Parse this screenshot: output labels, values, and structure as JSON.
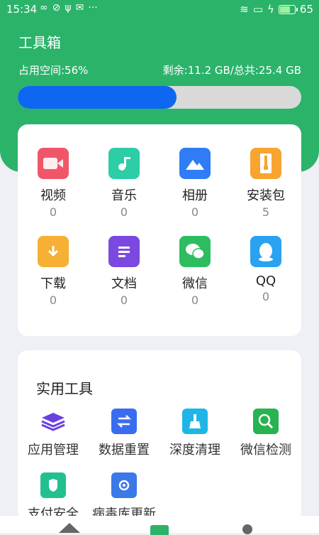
{
  "status": {
    "time": "15:34",
    "left_icons": [
      "infinity-icon",
      "check-circle-icon",
      "usb-icon",
      "mail-icon",
      "more-icon"
    ],
    "battery": "65"
  },
  "header": {
    "title": "工具箱",
    "usage_label": "占用空间:56%",
    "storage_label": "剩余:11.2 GB/总共:25.4 GB",
    "usage_percent": 56,
    "accent": "#2bb36a",
    "progress_color": "#0d67f0"
  },
  "categories": [
    {
      "label": "视频",
      "count": "0",
      "icon": "video-icon",
      "color": "#f0566a"
    },
    {
      "label": "音乐",
      "count": "0",
      "icon": "music-folder-icon",
      "color": "#2dcda5"
    },
    {
      "label": "相册",
      "count": "0",
      "icon": "photo-icon",
      "color": "#2f7cf6"
    },
    {
      "label": "安装包",
      "count": "5",
      "icon": "zip-icon",
      "color": "#f7a431"
    },
    {
      "label": "下载",
      "count": "0",
      "icon": "download-folder-icon",
      "color": "#f6b033"
    },
    {
      "label": "文档",
      "count": "0",
      "icon": "document-icon",
      "color": "#7b49e0"
    },
    {
      "label": "微信",
      "count": "0",
      "icon": "wechat-icon",
      "color": "#2dbd5f"
    },
    {
      "label": "QQ",
      "count": "0",
      "icon": "qq-icon",
      "color": "#2aa2f0"
    }
  ],
  "tools": {
    "title": "实用工具",
    "items": [
      {
        "label": "应用管理",
        "icon": "layers-icon",
        "color": "#6a3fe0"
      },
      {
        "label": "数据重置",
        "icon": "swap-icon",
        "color": "#3a6cf0"
      },
      {
        "label": "深度清理",
        "icon": "broom-icon",
        "color": "#1fb6e6"
      },
      {
        "label": "微信检测",
        "icon": "wechat-search-icon",
        "color": "#27b34f"
      },
      {
        "label": "支付安全",
        "icon": "wallet-shield-icon",
        "color": "#23c08f"
      },
      {
        "label": "病毒库更新",
        "icon": "virus-db-icon",
        "color": "#3b78e8"
      }
    ]
  }
}
